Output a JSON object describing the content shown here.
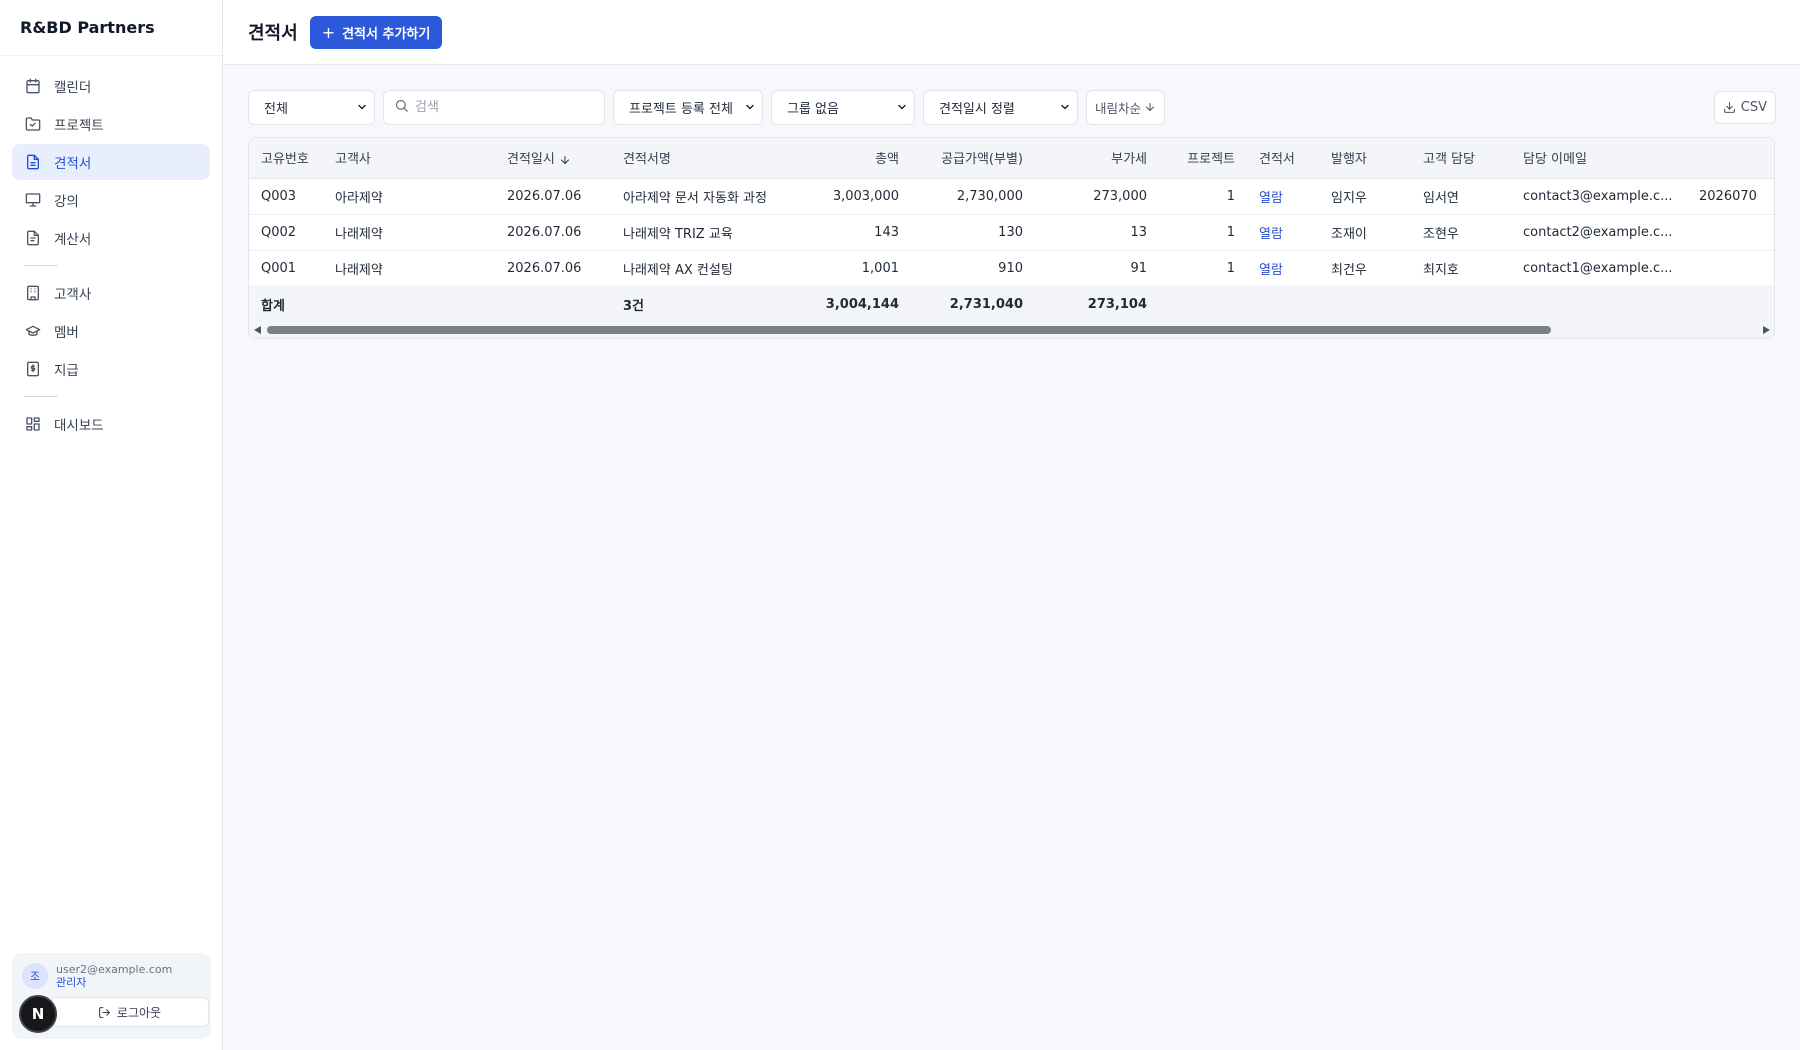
{
  "app": {
    "brand": "R&BD Partners"
  },
  "sidebar": {
    "groups": [
      [
        {
          "key": "calendar",
          "label": "캘린더",
          "icon": "calendar-icon",
          "active": false
        },
        {
          "key": "projects",
          "label": "프로젝트",
          "icon": "folder-icon",
          "active": false
        },
        {
          "key": "quotes",
          "label": "견적서",
          "icon": "document-icon",
          "active": true
        },
        {
          "key": "lectures",
          "label": "강의",
          "icon": "presentation-icon",
          "active": false
        },
        {
          "key": "invoices",
          "label": "계산서",
          "icon": "file-icon",
          "active": false
        }
      ],
      [
        {
          "key": "clients",
          "label": "고객사",
          "icon": "building-icon",
          "active": false
        },
        {
          "key": "members",
          "label": "멤버",
          "icon": "graduation-cap-icon",
          "active": false
        },
        {
          "key": "payments",
          "label": "지급",
          "icon": "receipt-icon",
          "active": false
        }
      ],
      [
        {
          "key": "dashboard",
          "label": "대시보드",
          "icon": "grid-icon",
          "active": false
        }
      ]
    ],
    "user": {
      "initial": "조",
      "email": "user2@example.com",
      "role": "관리자",
      "logout_label": "로그아웃"
    },
    "fab_label": "N"
  },
  "header": {
    "title": "견적서",
    "add_button": "견적서 추가하기"
  },
  "filters": {
    "status_value": "전체",
    "search_placeholder": "검색",
    "project_value": "프로젝트 등록 전체",
    "group_value": "그룹 없음",
    "sort_value": "견적일시 정렬",
    "order_label": "내림차순",
    "csv_label": "CSV"
  },
  "table": {
    "columns": [
      {
        "key": "id",
        "label": "고유번호",
        "align": "left",
        "width": 74
      },
      {
        "key": "client",
        "label": "고객사",
        "align": "left",
        "width": 172
      },
      {
        "key": "date",
        "label": "견적일시",
        "align": "left",
        "width": 116,
        "sorted": true
      },
      {
        "key": "name",
        "label": "견적서명",
        "align": "left",
        "width": 190
      },
      {
        "key": "total",
        "label": "총액",
        "align": "right",
        "width": 110
      },
      {
        "key": "supply",
        "label": "공급가액(부별)",
        "align": "right",
        "width": 124
      },
      {
        "key": "vat",
        "label": "부가세",
        "align": "right",
        "width": 124
      },
      {
        "key": "project",
        "label": "프로젝트",
        "align": "right",
        "width": 88
      },
      {
        "key": "doc",
        "label": "견적서",
        "align": "left",
        "width": 72
      },
      {
        "key": "issuer",
        "label": "발행자",
        "align": "left",
        "width": 92
      },
      {
        "key": "contact",
        "label": "고객 담당",
        "align": "left",
        "width": 100
      },
      {
        "key": "email",
        "label": "담당 이메일",
        "align": "left",
        "width": 176
      },
      {
        "key": "extra",
        "label": "",
        "align": "left",
        "width": 89
      }
    ],
    "rows": [
      {
        "id": "Q003",
        "client": "아라제약",
        "date": "2026.07.06",
        "name": "아라제약 문서 자동화 과정",
        "total": "3,003,000",
        "supply": "2,730,000",
        "vat": "273,000",
        "project": "1",
        "doc": "열람",
        "issuer": "임지우",
        "contact": "임서연",
        "email": "contact3@example.c...",
        "extra": "2026070"
      },
      {
        "id": "Q002",
        "client": "나래제약",
        "date": "2026.07.06",
        "name": "나래제약 TRIZ 교육",
        "total": "143",
        "supply": "130",
        "vat": "13",
        "project": "1",
        "doc": "열람",
        "issuer": "조재이",
        "contact": "조현우",
        "email": "contact2@example.c...",
        "extra": ""
      },
      {
        "id": "Q001",
        "client": "나래제약",
        "date": "2026.07.06",
        "name": "나래제약 AX 컨설팅",
        "total": "1,001",
        "supply": "910",
        "vat": "91",
        "project": "1",
        "doc": "열람",
        "issuer": "최건우",
        "contact": "최지호",
        "email": "contact1@example.c...",
        "extra": ""
      }
    ],
    "totals": {
      "id": "합계",
      "client": "",
      "date": "",
      "name": "3건",
      "total": "3,004,144",
      "supply": "2,731,040",
      "vat": "273,104",
      "project": "",
      "doc": "",
      "issuer": "",
      "contact": "",
      "email": "",
      "extra": ""
    }
  },
  "colors": {
    "accent": "#2b59d9",
    "active_bg": "#e8eefc",
    "link": "#2b4ed0"
  }
}
